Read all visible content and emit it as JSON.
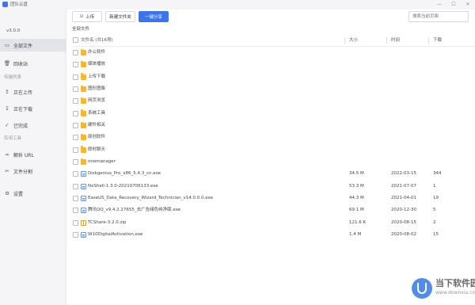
{
  "window": {
    "title": "团队云盘",
    "min_glyph": "—",
    "max_glyph": "☐",
    "close_glyph": "✕"
  },
  "sidebar": {
    "version": "v3.0.0",
    "items": [
      {
        "label": "全部文件",
        "icon": "folder-icon",
        "glyph": "▭",
        "active": true
      },
      {
        "label": "回收站",
        "icon": "trash-icon",
        "glyph": "🗑"
      }
    ],
    "transfer_section": "传输列表",
    "transfer_items": [
      {
        "label": "正在上传",
        "icon": "upload-icon",
        "glyph": "↥"
      },
      {
        "label": "正在下载",
        "icon": "download-icon",
        "glyph": "↧"
      },
      {
        "label": "已完成",
        "icon": "check-circle-icon",
        "glyph": "✓"
      }
    ],
    "tools_section": "实用工具",
    "tools_items": [
      {
        "label": "解析 URL",
        "icon": "link-icon",
        "glyph": "∞"
      },
      {
        "label": "文件分割",
        "icon": "scissors-icon",
        "glyph": "✂"
      }
    ],
    "settings_label": "设置",
    "settings_glyph": "⚙"
  },
  "toolbar": {
    "upload_label": "上传",
    "upload_glyph": "⊙",
    "new_folder_label": "新建文件夹",
    "share_label": "一键分享",
    "search_placeholder": "搜索当前页面"
  },
  "breadcrumb": "全部文件",
  "table": {
    "headers": {
      "name": "文件名 (共16项)",
      "size": "大小",
      "time": "时间",
      "downloads": "下载"
    },
    "rows": [
      {
        "type": "folder",
        "name": "办公软件",
        "size": "",
        "time": "",
        "downloads": ""
      },
      {
        "type": "folder",
        "name": "媒体播放",
        "size": "",
        "time": "",
        "downloads": ""
      },
      {
        "type": "folder",
        "name": "上传下载",
        "size": "",
        "time": "",
        "downloads": ""
      },
      {
        "type": "folder",
        "name": "图形图像",
        "size": "",
        "time": "",
        "downloads": ""
      },
      {
        "type": "folder",
        "name": "网页浏览",
        "size": "",
        "time": "",
        "downloads": ""
      },
      {
        "type": "folder",
        "name": "系统工具",
        "size": "",
        "time": "",
        "downloads": ""
      },
      {
        "type": "folder",
        "name": "硬件相关",
        "size": "",
        "time": "",
        "downloads": ""
      },
      {
        "type": "folder",
        "name": "原创软件",
        "size": "",
        "time": "",
        "downloads": ""
      },
      {
        "type": "folder",
        "name": "即时聊天",
        "size": "",
        "time": "",
        "downloads": ""
      },
      {
        "type": "folder",
        "name": "onemanager",
        "size": "",
        "time": "",
        "downloads": ""
      },
      {
        "type": "file",
        "name": "Diskgenius_Pro_x86_5.4.3_cn.exe",
        "size": "34.5 M",
        "time": "2022-03-15",
        "downloads": "344"
      },
      {
        "type": "file",
        "name": "NxShell-1.3.0-20210706133.exe",
        "size": "53.3 M",
        "time": "2021-07-07",
        "downloads": "1"
      },
      {
        "type": "file",
        "name": "EaseUS_Data_Recovery_Wizard_Technician_v14.0.0.0.exe",
        "size": "44.3 M",
        "time": "2021-04-01",
        "downloads": "19"
      },
      {
        "type": "file",
        "name": "腾讯QQ_v9.4.2.27655_去广告绿色纯净版.exe",
        "size": "69.1 M",
        "time": "2020-12-30",
        "downloads": "5"
      },
      {
        "type": "zip",
        "name": "TCShare-3.2.0.zip",
        "size": "121.6 K",
        "time": "2020-08-15",
        "downloads": "2"
      },
      {
        "type": "file",
        "name": "W10DigitalActivation.exe",
        "size": "1.4 M",
        "time": "2020-08-02",
        "downloads": "15"
      }
    ]
  },
  "watermark": {
    "text": "当下软件园",
    "sub": "www.downxia.com"
  }
}
